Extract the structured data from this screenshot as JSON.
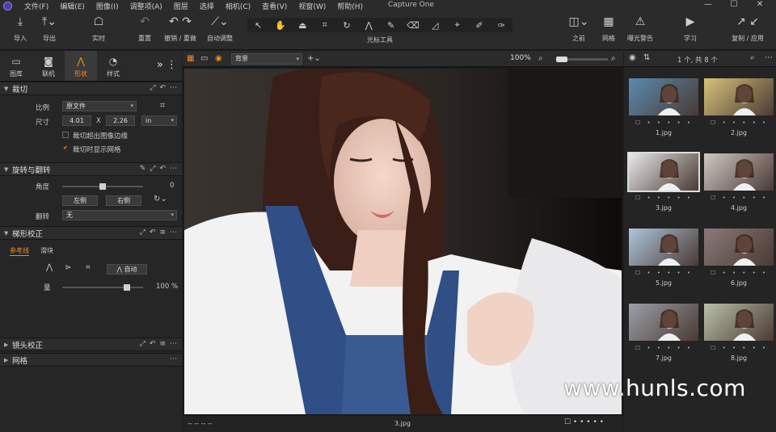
{
  "menubar": {
    "items": [
      "文件(F)",
      "编辑(E)",
      "图像(I)",
      "调整项(A)",
      "图层",
      "选择",
      "相机(C)",
      "查看(V)",
      "视窗(W)",
      "帮助(H)"
    ],
    "app_title": "Capture One",
    "win_min": "—",
    "win_max": "☐",
    "win_close": "✕"
  },
  "toolbar": {
    "import": "导入",
    "export": "导出",
    "live": "实时",
    "reset": "重置",
    "undo_redo": "撤销 / 重做",
    "auto_adjust": "自动调整",
    "cursor_tools": "光标工具",
    "before": "之前",
    "grid": "网格",
    "exposure_warning": "曝光警告",
    "learn": "学习",
    "copy_apply": "复制 / 应用"
  },
  "left_tabs": [
    {
      "icon": "folder-icon",
      "label": "图库"
    },
    {
      "icon": "camera-icon",
      "label": "联机"
    },
    {
      "icon": "shape-icon",
      "label": "形状"
    },
    {
      "icon": "style-icon",
      "label": "样式"
    }
  ],
  "crop": {
    "title": "裁切",
    "ratio_label": "比例",
    "ratio_value": "原文件",
    "size_label": "尺寸",
    "width": "4.01",
    "x": "X",
    "height": "2.26",
    "unit": "in",
    "opt1": "裁切超出图像边缘",
    "opt2": "裁切时显示网格"
  },
  "rotate": {
    "title": "旋转与翻转",
    "angle_label": "角度",
    "angle_value": "0",
    "left_btn": "左侧",
    "right_btn": "右侧",
    "flip_label": "翻转",
    "flip_value": "无",
    "angle_level": 0.5
  },
  "keystone": {
    "title": "梯形校正",
    "tab1": "参考线",
    "tab2": "滑块",
    "auto_btn": "自动",
    "amount_label": "量",
    "amount_value": "100",
    "amount_unit": "%",
    "amount_level": 1.0
  },
  "lens": {
    "title": "镜头校正"
  },
  "gridsec": {
    "title": "网格"
  },
  "viewer": {
    "select_value": "背景",
    "zoom": "100%",
    "status_left": "--     --     --     --",
    "filename": "3.jpg"
  },
  "browser": {
    "count": "1 个, 共 8 个",
    "items": [
      {
        "name": "1.jpg"
      },
      {
        "name": "2.jpg"
      },
      {
        "name": "3.jpg"
      },
      {
        "name": "4.jpg"
      },
      {
        "name": "5.jpg"
      },
      {
        "name": "6.jpg"
      },
      {
        "name": "7.jpg"
      },
      {
        "name": "8.jpg"
      }
    ]
  },
  "watermark": "www.hunls.com",
  "colors": {
    "accent": "#f08a24",
    "bg": "#1e1e1e",
    "panel": "#262626"
  }
}
